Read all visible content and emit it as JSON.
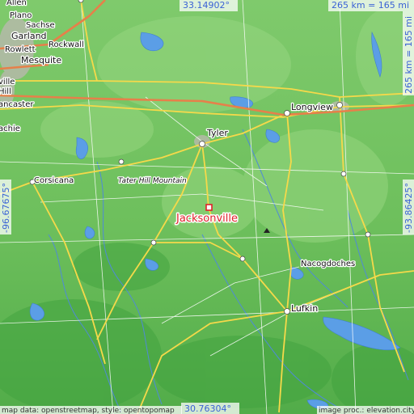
{
  "map": {
    "target_city": "Jacksonville",
    "coords": {
      "top": "33.14902°",
      "bottom": "30.76304°",
      "left": "-96.67675°",
      "right": "-93.86425°"
    },
    "scale_top": "265 km = 165 mi",
    "scale_right": "265 km = 165 mi",
    "credit_left": "map data: openstreetmap, style: opentopomap",
    "credit_right": "image proc.: elevation.city",
    "cities": {
      "allen": "Allen",
      "plano": "Plano",
      "sachse": "Sachse",
      "garland": "Garland",
      "rockwall": "Rockwall",
      "rowlett": "Rowlett",
      "mesquite": "Mesquite",
      "ville": "ville",
      "hill": "Hill",
      "lancaster": "ancaster",
      "waxahachie": "achie",
      "corsicana": "Corsicana",
      "tyler": "Tyler",
      "longview": "Longview",
      "nacogdoches": "Nacogdoches",
      "lufkin": "Lufkin",
      "tater_hill": "Tater Hill Mountain"
    }
  }
}
